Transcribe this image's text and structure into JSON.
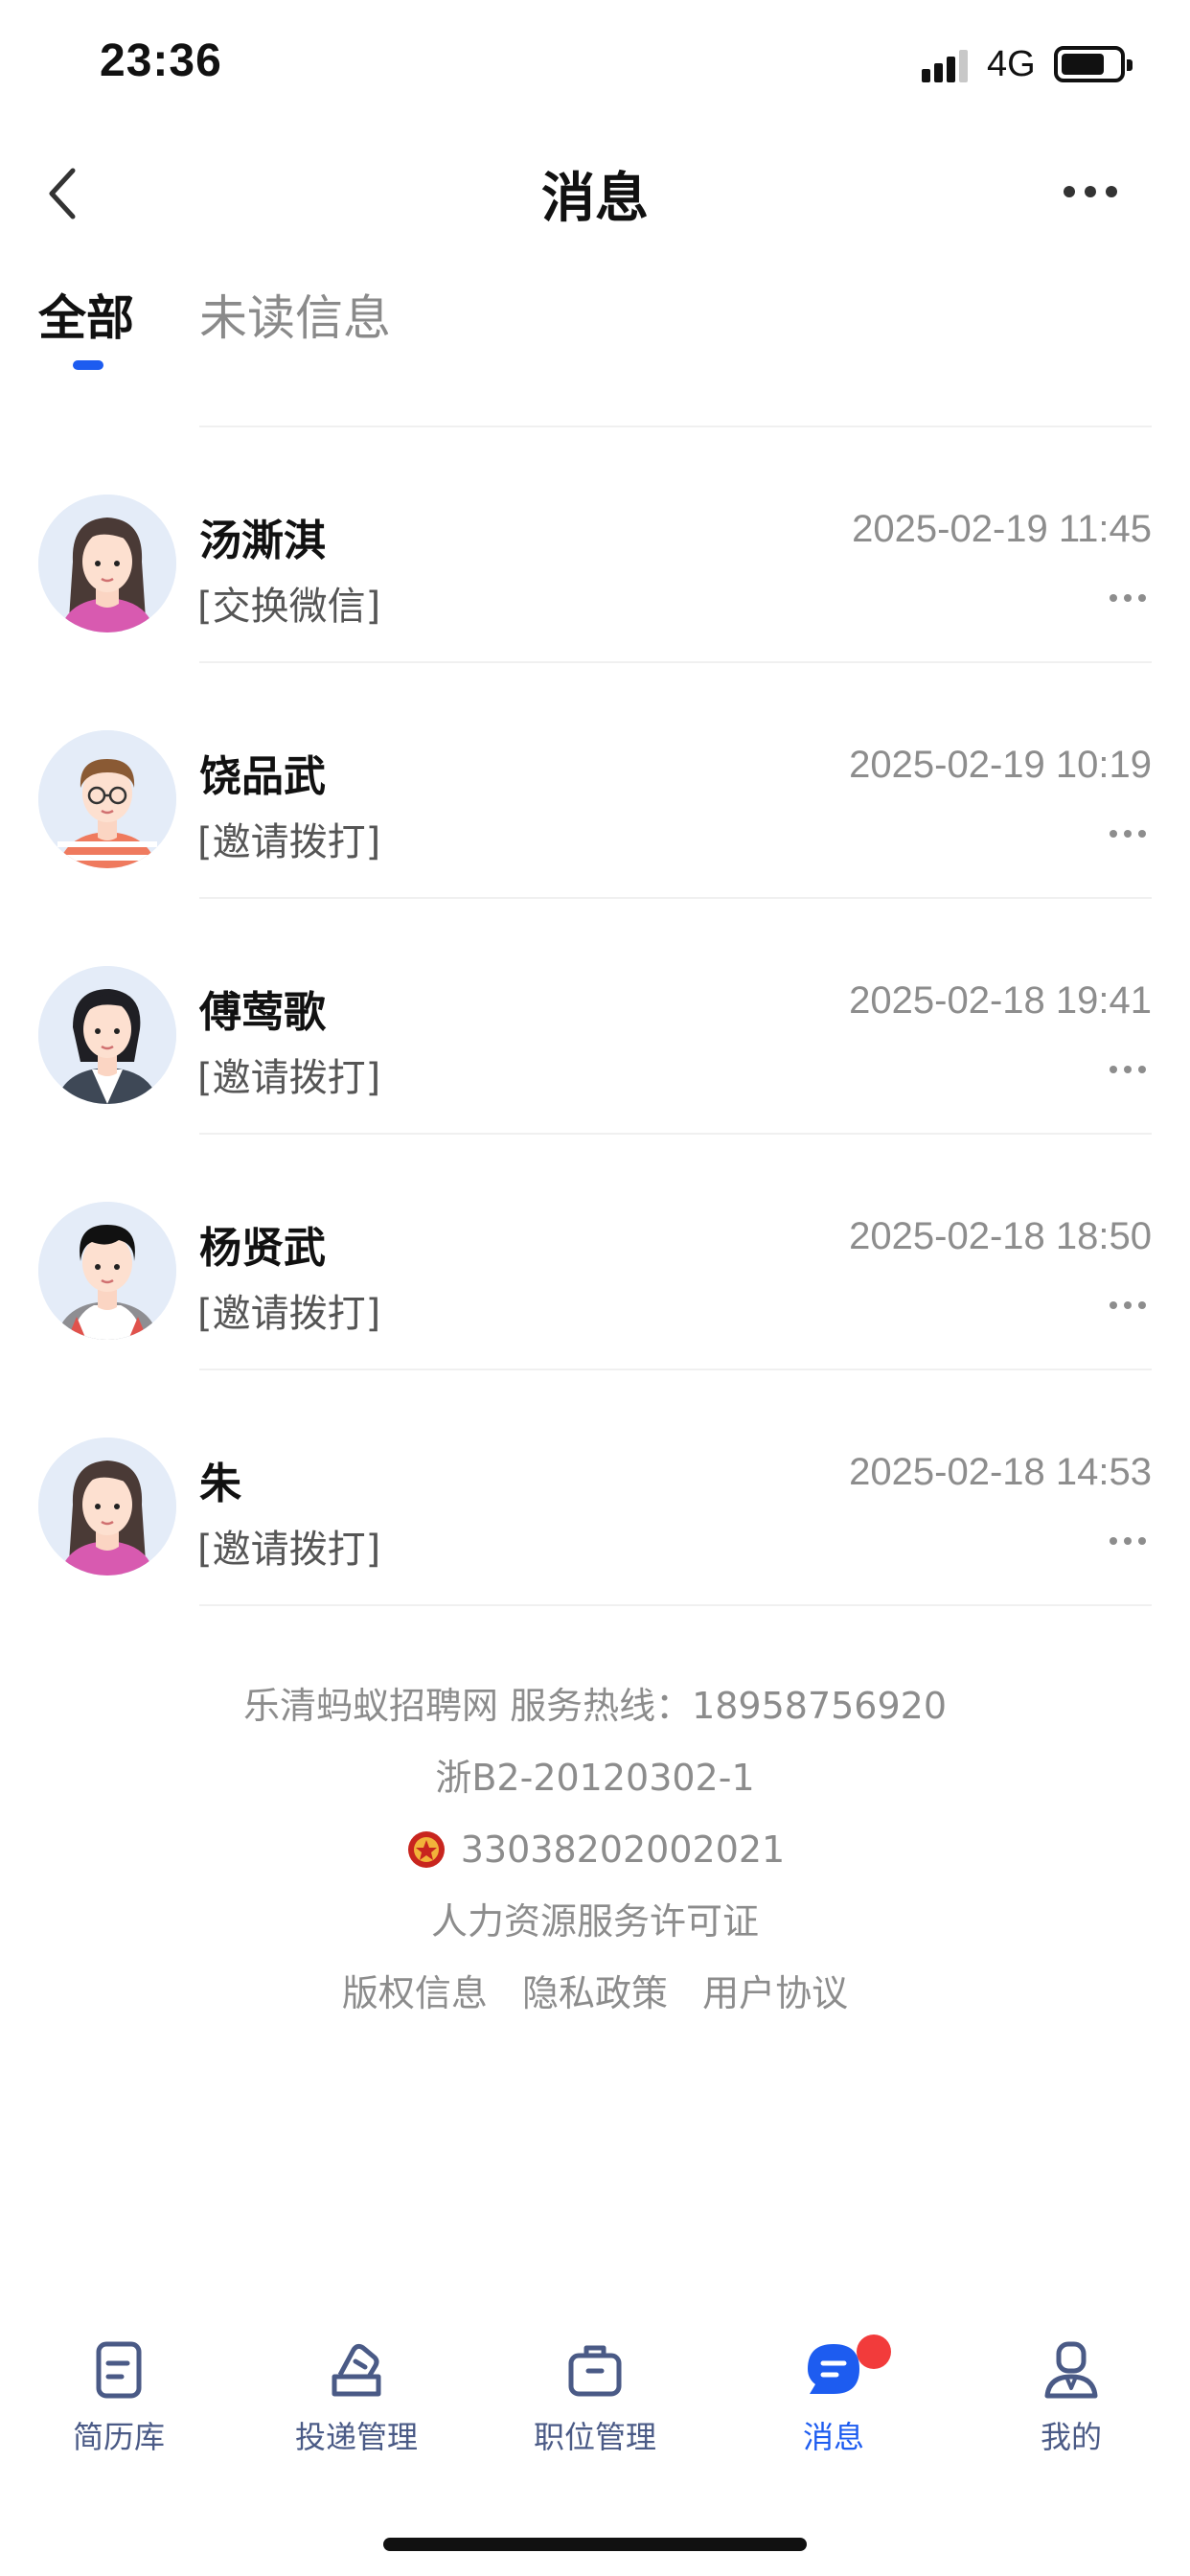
{
  "status_bar": {
    "time": "23:36",
    "network": "4G"
  },
  "nav": {
    "title": "消息",
    "back_icon": "chevron-left-icon",
    "more_icon": "more-horizontal-icon"
  },
  "tabs": [
    {
      "label": "全部",
      "active": true
    },
    {
      "label": "未读信息",
      "active": false
    }
  ],
  "messages": [
    {
      "name": "汤澌淇",
      "time": "2025-02-19 11:45",
      "preview": "[交换微信]",
      "avatar": "female-avatar-long-hair"
    },
    {
      "name": "饶品武",
      "time": "2025-02-19 10:19",
      "preview": "[邀请拨打]",
      "avatar": "male-avatar-glasses"
    },
    {
      "name": "傅莺歌",
      "time": "2025-02-18 19:41",
      "preview": "[邀请拨打]",
      "avatar": "female-avatar-suit"
    },
    {
      "name": "杨贤武",
      "time": "2025-02-18 18:50",
      "preview": "[邀请拨打]",
      "avatar": "male-avatar"
    },
    {
      "name": "朱",
      "time": "2025-02-18 14:53",
      "preview": "[邀请拨打]",
      "avatar": "female-avatar-long-hair"
    }
  ],
  "footer": {
    "company_line": "乐清蚂蚁招聘网  服务热线：18958756920",
    "icp": "浙B2-20120302-1",
    "police_record": "33038202002021",
    "license": "人力资源服务许可证",
    "links": [
      "版权信息",
      "隐私政策",
      "用户协议"
    ]
  },
  "tabbar": [
    {
      "label": "简历库",
      "icon": "resume-icon",
      "active": false
    },
    {
      "label": "投递管理",
      "icon": "delivery-icon",
      "active": false
    },
    {
      "label": "职位管理",
      "icon": "briefcase-icon",
      "active": false
    },
    {
      "label": "消息",
      "icon": "message-icon",
      "active": true,
      "badge": true
    },
    {
      "label": "我的",
      "icon": "profile-icon",
      "active": false
    }
  ],
  "colors": {
    "accent": "#1d5cf0",
    "badge": "#f23b3b",
    "muted_text": "#8d8d8d"
  }
}
